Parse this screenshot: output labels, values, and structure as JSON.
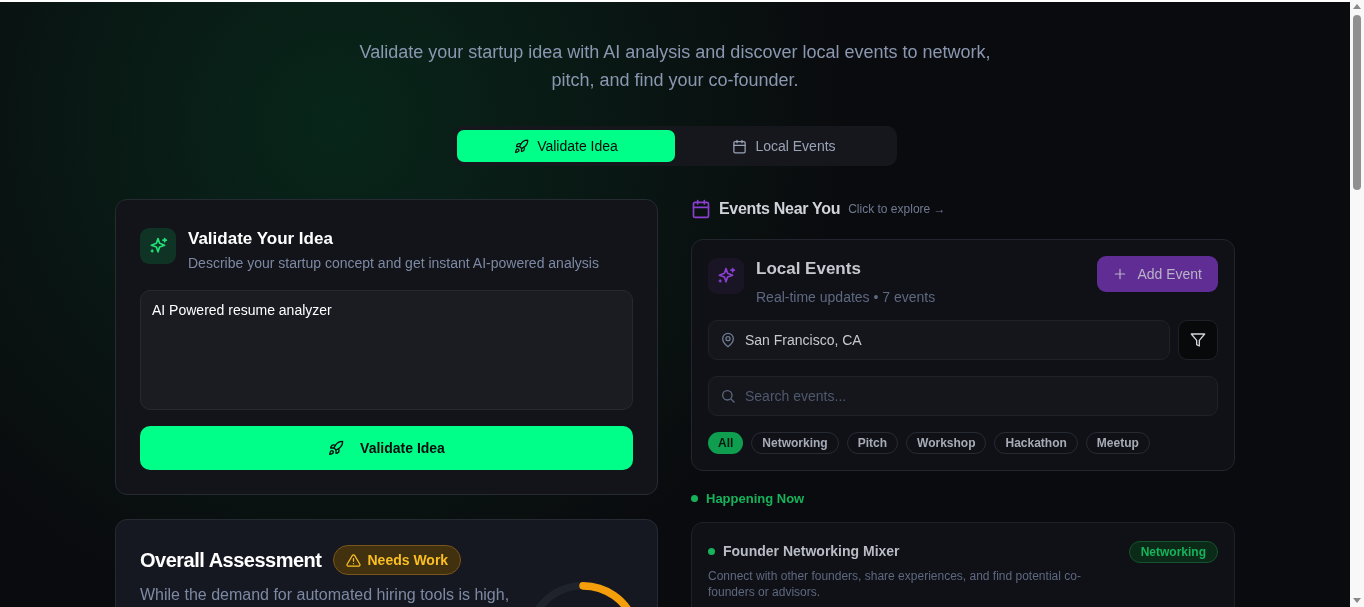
{
  "header": {
    "subtitle": "Validate your startup idea with AI analysis and discover local events to network, pitch, and find your co-founder."
  },
  "tabs": [
    {
      "label": "Validate Idea",
      "kind": "rocket",
      "selected": true
    },
    {
      "label": "Local Events",
      "kind": "calendar",
      "selected": false
    }
  ],
  "validate_card": {
    "title": "Validate Your Idea",
    "subtitle": "Describe your startup concept and get instant AI-powered analysis",
    "idea": "AI Powered resume analyzer",
    "button": "Validate Idea"
  },
  "assessment": {
    "title": "Overall Assessment",
    "badge": "Needs Work",
    "text": "While the demand for automated hiring tools is high,"
  },
  "events_section": {
    "heading": "Events Near You",
    "hint": "Click to explore →"
  },
  "local_events": {
    "title": "Local Events",
    "subtitle": "Real-time updates • 7 events",
    "add_button": "Add Event",
    "location": "San Francisco, CA",
    "search_placeholder": "Search events...",
    "filters": [
      {
        "label": "All",
        "selected": true
      },
      {
        "label": "Networking",
        "selected": false
      },
      {
        "label": "Pitch",
        "selected": false
      },
      {
        "label": "Workshop",
        "selected": false
      },
      {
        "label": "Hackathon",
        "selected": false
      },
      {
        "label": "Meetup",
        "selected": false
      }
    ]
  },
  "happening": {
    "label": "Happening Now"
  },
  "events": [
    {
      "title": "Founder Networking Mixer",
      "description": "Connect with other founders, share experiences, and find potential co-founders or advisors.",
      "category": "Networking"
    }
  ]
}
